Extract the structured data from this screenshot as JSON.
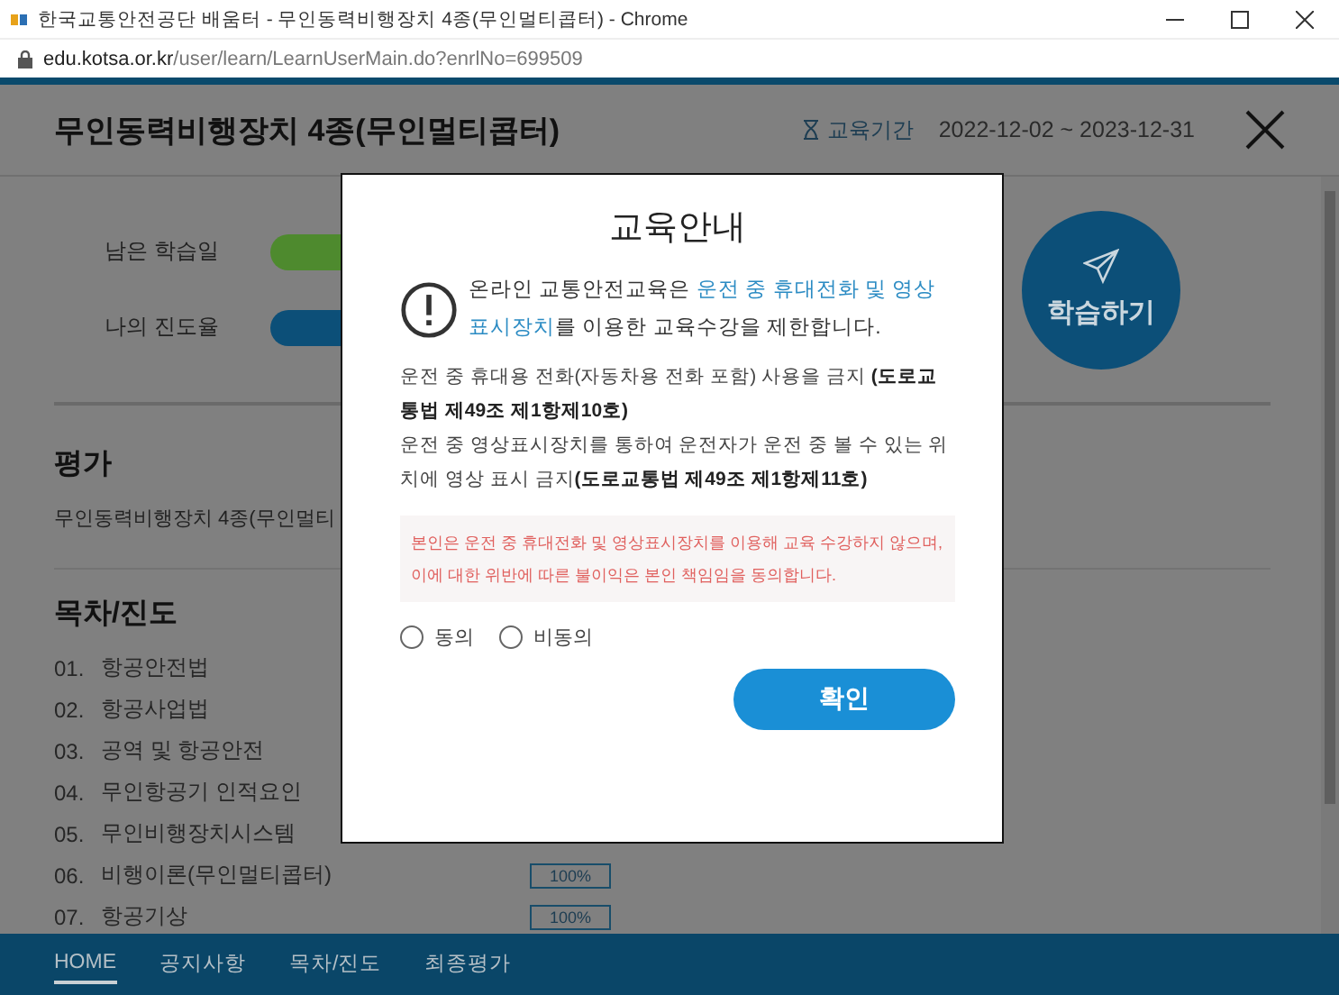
{
  "browser": {
    "tab_title": "한국교통안전공단 배움터 - 무인동력비행장치 4종(무인멀티콥터) - Chrome",
    "address": {
      "host": "edu.kotsa.or.kr",
      "path": "/user/learn/LearnUserMain.do?enrlNo=699509"
    }
  },
  "header": {
    "title": "무인동력비행장치 4종(무인멀티콥터)",
    "period_label": "교육기간",
    "period": "2022-12-02 ~ 2023-12-31"
  },
  "status": [
    {
      "label": "남은 학습일",
      "color": "#4e8a2e"
    },
    {
      "label": "나의 진도율",
      "color": "#0c4f78"
    }
  ],
  "study_button": "학습하기",
  "evaluation": {
    "heading": "평가",
    "course": "무인동력비행장치 4종(무인멀티"
  },
  "contents": {
    "heading": "목차/진도",
    "items": [
      {
        "number": "01.",
        "title": "항공안전법"
      },
      {
        "number": "02.",
        "title": "항공사업법"
      },
      {
        "number": "03.",
        "title": "공역 및 항공안전"
      },
      {
        "number": "04.",
        "title": "무인항공기 인적요인"
      },
      {
        "number": "05.",
        "title": "무인비행장치시스템"
      },
      {
        "number": "06.",
        "title": "비행이론(무인멀티콥터)",
        "progress": "100%"
      },
      {
        "number": "07.",
        "title": "항공기상",
        "progress": "100%"
      }
    ]
  },
  "bottom_nav": [
    {
      "label": "HOME",
      "selected": true
    },
    {
      "label": "공지사항",
      "selected": false
    },
    {
      "label": "목차/진도",
      "selected": false
    },
    {
      "label": "최종평가",
      "selected": false
    }
  ],
  "dialog": {
    "title": "교육안내",
    "notice": [
      {
        "text": "온라인 교통안전교육은 ",
        "highlight": false
      },
      {
        "text": "운전 중 휴대전화 및 영상표시장치",
        "highlight": true
      },
      {
        "text": "를 이용한 교육수강을 제한합니다.",
        "highlight": false
      }
    ],
    "rules": [
      "운전 중 휴대용 전화(자동차용 전화 포함) 사용을 금지 **(도로교통법 제49조 제1항제10호)**",
      "운전 중 영상표시장치를 통하여 운전자가 운전 중 볼 수 있는 위치에 영상 표시 금지**(도로교통법 제49조 제1항제11호)**"
    ],
    "pledge": "본인은 운전 중 휴대전화 및 영상표시장치를 이용해 교육 수강하지 않으며, 이에 대한 위반에 따른 불이익은 본인 책임임을 동의합니다.",
    "options": [
      {
        "label": "동의",
        "selected": false
      },
      {
        "label": "비동의",
        "selected": false
      }
    ],
    "confirm": "확인"
  }
}
